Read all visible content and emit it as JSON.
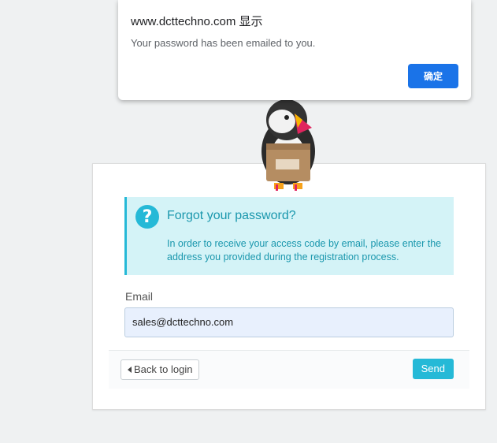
{
  "dialog": {
    "title": "www.dcttechno.com 显示",
    "message": "Your password has been emailed to you.",
    "ok_label": "确定"
  },
  "alert": {
    "icon": "question-circle-icon",
    "title": "Forgot your password?",
    "text": "In order to receive your access code by email, please enter the address you provided during the registration process."
  },
  "form": {
    "email_label": "Email",
    "email_value": "sales@dcttechno.com"
  },
  "footer": {
    "back_label": "Back to login",
    "send_label": "Send"
  },
  "colors": {
    "accent": "#25b9d7",
    "dialog_button": "#1a73e8",
    "alert_bg": "#d4f3f7"
  }
}
